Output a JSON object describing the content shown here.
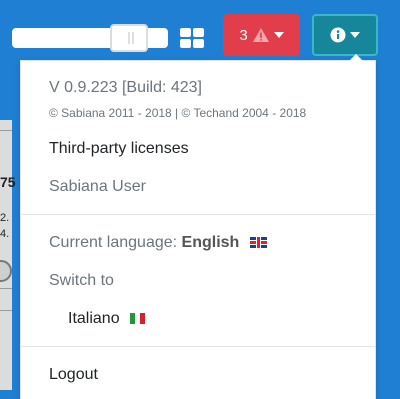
{
  "topbar": {
    "alerts_count": "3",
    "alert_icon": "warning-triangle-icon",
    "grid_icon": "grid-icon",
    "info_icon": "info-icon"
  },
  "background_marks": [
    "75",
    "2.",
    "4."
  ],
  "menu": {
    "version": "V 0.9.223 [Build: 423]",
    "copyright": "© Sabiana 2011 - 2018 | © Techand 2004 - 2018",
    "third_party": "Third-party licenses",
    "user": "Sabiana User",
    "current_language_label": "Current language:",
    "current_language": "English",
    "switch_to": "Switch to",
    "other_language": "Italiano",
    "logout": "Logout"
  },
  "colors": {
    "background": "#1f7fd2",
    "alert": "#e23d4a",
    "info": "#16869a"
  }
}
